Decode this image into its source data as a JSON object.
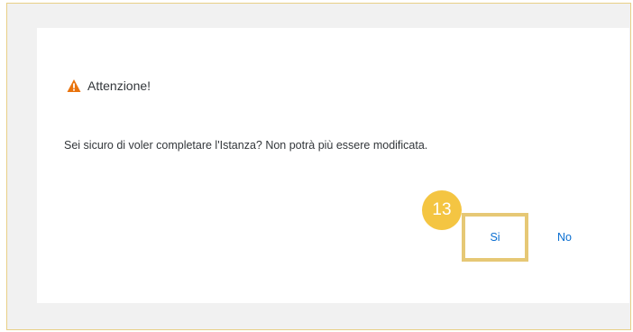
{
  "dialog": {
    "title": "Attenzione!",
    "message": "Sei sicuro di voler completare l'Istanza? Non potrà più essere modificata.",
    "yes_label": "Si",
    "no_label": "No"
  },
  "tutorial": {
    "step_number": "13"
  },
  "colors": {
    "warning": "#e9730c",
    "link": "#0a6ed1",
    "highlight": "#e6c875",
    "badge": "#f4c542"
  },
  "icons": {
    "title": "warning-icon"
  }
}
